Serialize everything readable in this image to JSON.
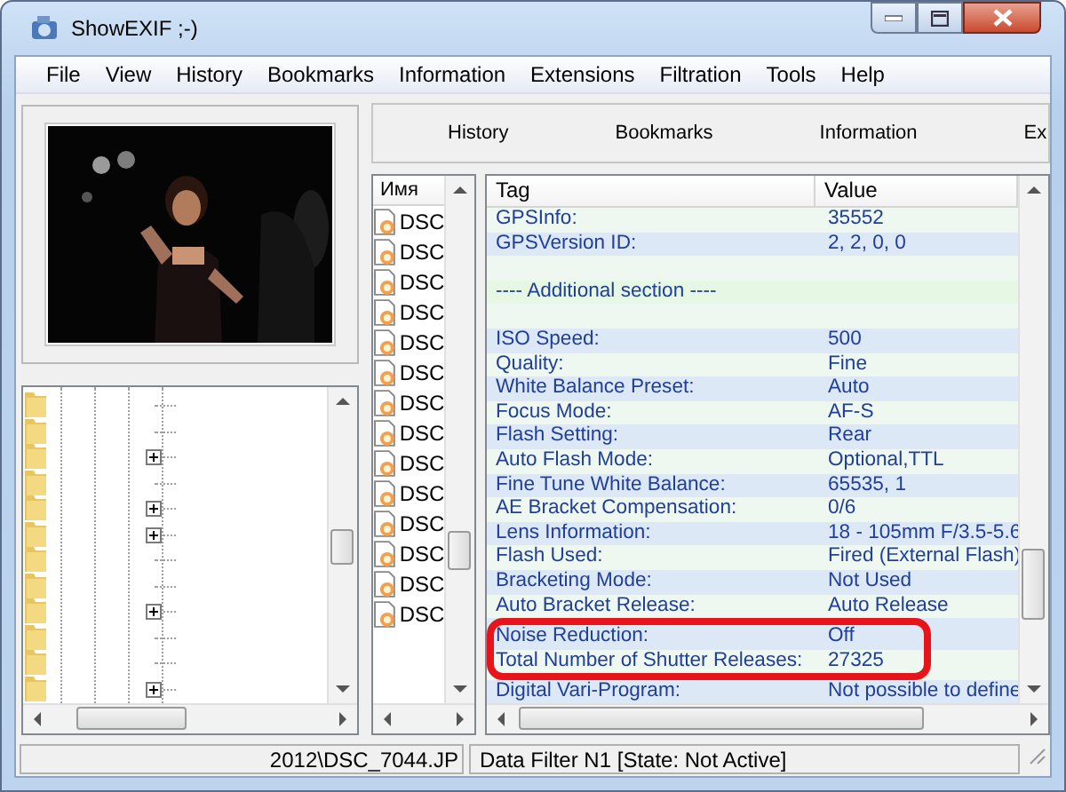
{
  "window": {
    "title": "ShowEXIF ;-)"
  },
  "menu": [
    "File",
    "View",
    "History",
    "Bookmarks",
    "Information",
    "Extensions",
    "Filtration",
    "Tools",
    "Help"
  ],
  "tree": {
    "items": [
      {
        "expandable": false
      },
      {
        "expandable": false
      },
      {
        "expandable": true
      },
      {
        "expandable": false
      },
      {
        "expandable": true
      },
      {
        "expandable": true
      },
      {
        "expandable": false
      },
      {
        "expandable": false
      },
      {
        "expandable": true
      },
      {
        "expandable": false
      },
      {
        "expandable": false
      },
      {
        "expandable": true
      }
    ]
  },
  "toolbar": {
    "tabs": [
      "History",
      "Bookmarks",
      "Information",
      "Ex"
    ]
  },
  "file_list": {
    "column": "Имя",
    "items": [
      {
        "name": "DSC"
      },
      {
        "name": "DSC"
      },
      {
        "name": "DSC"
      },
      {
        "name": "DSC"
      },
      {
        "name": "DSC"
      },
      {
        "name": "DSC"
      },
      {
        "name": "DSC"
      },
      {
        "name": "DSC"
      },
      {
        "name": "DSC"
      },
      {
        "name": "DSC"
      },
      {
        "name": "DSC"
      },
      {
        "name": "DSC"
      },
      {
        "name": "DSC"
      },
      {
        "name": "DSC"
      }
    ]
  },
  "exif_table": {
    "columns": [
      "Tag",
      "Value"
    ],
    "rows": [
      {
        "kind": "entry",
        "tag": "GPSInfo:",
        "value": "35552",
        "highlighted": false
      },
      {
        "kind": "entry",
        "tag": "GPSVersion ID:",
        "value": "2, 2, 0, 0",
        "highlighted": false
      },
      {
        "kind": "blank"
      },
      {
        "kind": "section",
        "tag": "---- Additional section ----"
      },
      {
        "kind": "blank"
      },
      {
        "kind": "entry",
        "tag": "ISO Speed:",
        "value": "500",
        "highlighted": false
      },
      {
        "kind": "entry",
        "tag": "Quality:",
        "value": "Fine",
        "highlighted": false
      },
      {
        "kind": "entry",
        "tag": "White Balance Preset:",
        "value": "Auto",
        "highlighted": false
      },
      {
        "kind": "entry",
        "tag": "Focus Mode:",
        "value": "AF-S",
        "highlighted": false
      },
      {
        "kind": "entry",
        "tag": "Flash Setting:",
        "value": "Rear",
        "highlighted": false
      },
      {
        "kind": "entry",
        "tag": "Auto Flash Mode:",
        "value": "Optional,TTL",
        "highlighted": false
      },
      {
        "kind": "entry",
        "tag": "Fine Tune White Balance:",
        "value": "65535, 1",
        "highlighted": false
      },
      {
        "kind": "entry",
        "tag": "AE Bracket Compensation:",
        "value": "0/6",
        "highlighted": false
      },
      {
        "kind": "entry",
        "tag": "Lens Information:",
        "value": "18 - 105mm  F/3.5-5.6",
        "highlighted": false
      },
      {
        "kind": "entry",
        "tag": "Flash Used:",
        "value": "Fired (External Flash)",
        "highlighted": false
      },
      {
        "kind": "entry",
        "tag": "Bracketing Mode:",
        "value": "Not Used",
        "highlighted": false
      },
      {
        "kind": "entry",
        "tag": "Auto Bracket Release:",
        "value": "Auto Release",
        "highlighted": false
      },
      {
        "kind": "entry",
        "tag": "Noise Reduction:",
        "value": "Off",
        "highlighted": true
      },
      {
        "kind": "entry",
        "tag": "Total Number of Shutter Releases:",
        "value": "27325",
        "highlighted": true
      },
      {
        "kind": "entry",
        "tag": "Digital Vari-Program:",
        "value": "Not possible to define",
        "highlighted": false
      }
    ]
  },
  "status_bar": {
    "path": "2012\\DSC_7044.JP",
    "filter": "Data Filter N1 [State: Not Active]"
  }
}
